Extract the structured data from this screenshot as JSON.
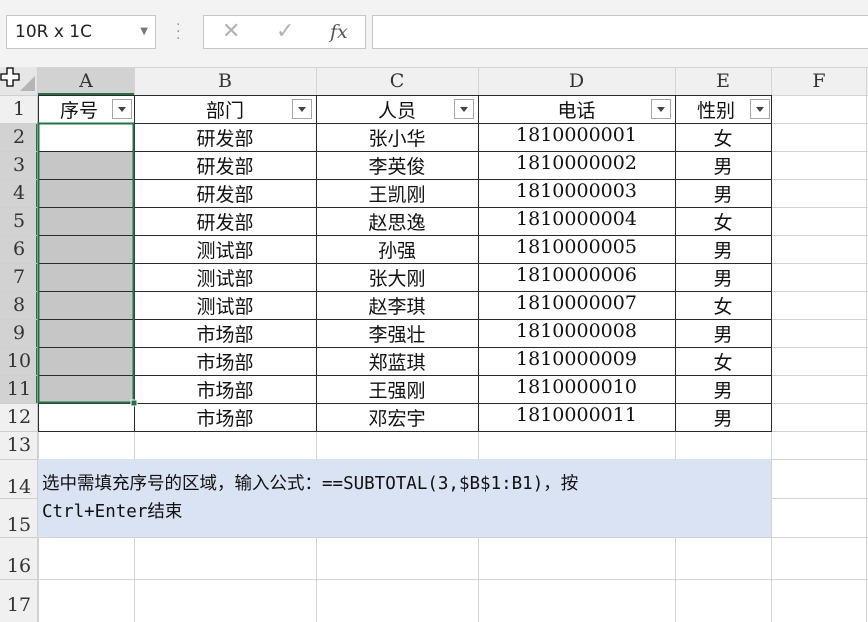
{
  "name_box": {
    "value": "10R x 1C"
  },
  "formula_bar": {
    "cancel_icon": "close-icon",
    "enter_icon": "check-icon",
    "fx_label": "fx",
    "formula": ""
  },
  "columns": [
    "A",
    "B",
    "C",
    "D",
    "E",
    "F"
  ],
  "rows": [
    "1",
    "2",
    "3",
    "4",
    "5",
    "6",
    "7",
    "8",
    "9",
    "10",
    "11",
    "12",
    "13",
    "14",
    "15",
    "16",
    "17"
  ],
  "table": {
    "headers": [
      "序号",
      "部门",
      "人员",
      "电话",
      "性别"
    ],
    "rows": [
      [
        "",
        "研发部",
        "张小华",
        "1810000001",
        "女"
      ],
      [
        "",
        "研发部",
        "李英俊",
        "1810000002",
        "男"
      ],
      [
        "",
        "研发部",
        "王凯刚",
        "1810000003",
        "男"
      ],
      [
        "",
        "研发部",
        "赵思逸",
        "1810000004",
        "女"
      ],
      [
        "",
        "测试部",
        "孙强",
        "1810000005",
        "男"
      ],
      [
        "",
        "测试部",
        "张大刚",
        "1810000006",
        "男"
      ],
      [
        "",
        "测试部",
        "赵李琪",
        "1810000007",
        "女"
      ],
      [
        "",
        "市场部",
        "李强壮",
        "1810000008",
        "男"
      ],
      [
        "",
        "市场部",
        "郑蓝琪",
        "1810000009",
        "女"
      ],
      [
        "",
        "市场部",
        "王强刚",
        "1810000010",
        "男"
      ],
      [
        "",
        "市场部",
        "邓宏宇",
        "1810000011",
        "男"
      ]
    ]
  },
  "note": {
    "line1": "选中需填充序号的区域，输入公式：==SUBTOTAL(3,$B$1:B1)，按",
    "line2": "Ctrl+Enter结束"
  },
  "colors": {
    "selection_fill": "#c6c6c6",
    "selection_border": "#217346",
    "note_fill": "#dae3f3",
    "header_active": "#d2d2d2"
  }
}
